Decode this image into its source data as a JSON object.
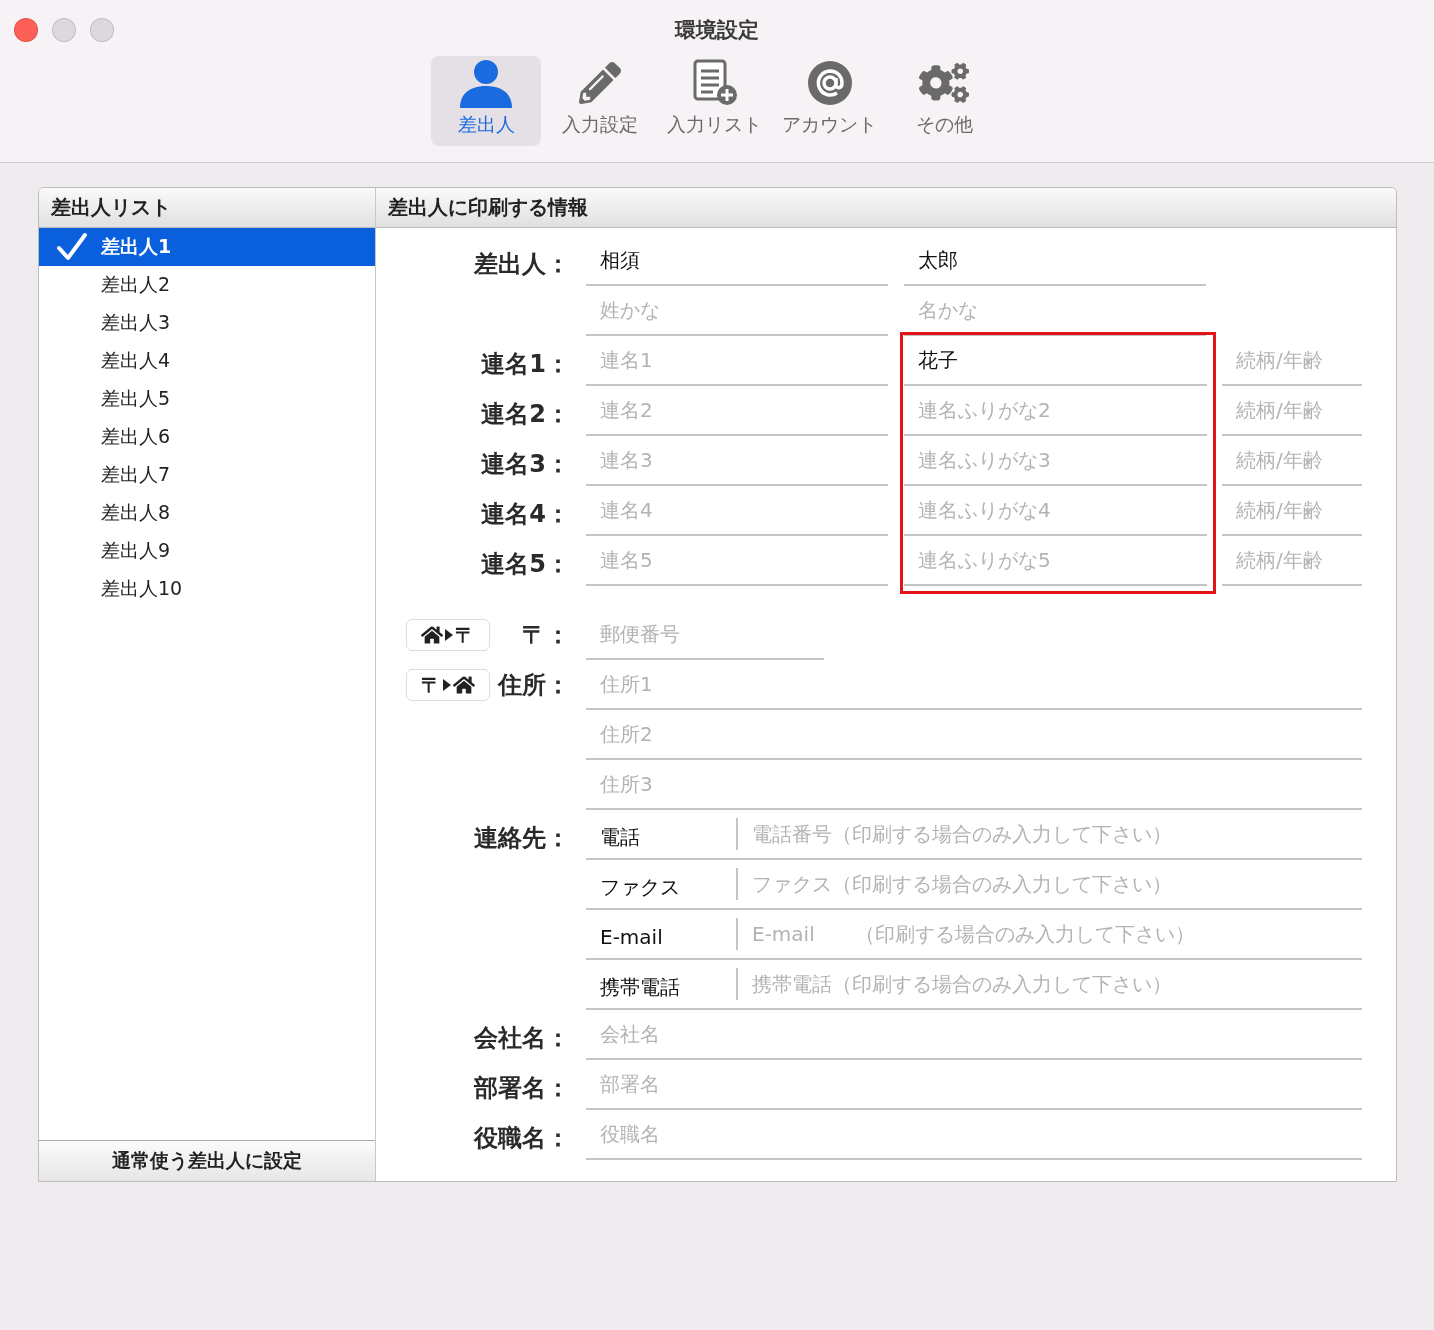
{
  "window": {
    "title": "環境設定"
  },
  "toolbar": [
    {
      "kind": "person",
      "label": "差出人",
      "selected": true
    },
    {
      "kind": "pencil",
      "label": "入力設定",
      "selected": false
    },
    {
      "kind": "list",
      "label": "入力リスト",
      "selected": false
    },
    {
      "kind": "at",
      "label": "アカウント",
      "selected": false
    },
    {
      "kind": "gears",
      "label": "その他",
      "selected": false
    }
  ],
  "sender_list": {
    "title": "差出人リスト",
    "items": [
      {
        "label": "差出人1",
        "selected": true
      },
      {
        "label": "差出人2",
        "selected": false
      },
      {
        "label": "差出人3",
        "selected": false
      },
      {
        "label": "差出人4",
        "selected": false
      },
      {
        "label": "差出人5",
        "selected": false
      },
      {
        "label": "差出人6",
        "selected": false
      },
      {
        "label": "差出人7",
        "selected": false
      },
      {
        "label": "差出人8",
        "selected": false
      },
      {
        "label": "差出人9",
        "selected": false
      },
      {
        "label": "差出人10",
        "selected": false
      }
    ],
    "button": "通常使う差出人に設定"
  },
  "form": {
    "title": "差出人に印刷する情報",
    "sender": {
      "label": "差出人：",
      "last_name": {
        "value": "相須"
      },
      "first_name": {
        "value": "太郎"
      },
      "last_kana": {
        "placeholder": "姓かな"
      },
      "first_kana": {
        "placeholder": "名かな"
      }
    },
    "joint_names_highlighted": true,
    "joint_names": [
      {
        "label": "連名1：",
        "name": {
          "placeholder": "連名1"
        },
        "furigana": {
          "value": "花子"
        },
        "relation": {
          "placeholder": "続柄/年齢"
        }
      },
      {
        "label": "連名2：",
        "name": {
          "placeholder": "連名2"
        },
        "furigana": {
          "placeholder": "連名ふりがな2"
        },
        "relation": {
          "placeholder": "続柄/年齢"
        }
      },
      {
        "label": "連名3：",
        "name": {
          "placeholder": "連名3"
        },
        "furigana": {
          "placeholder": "連名ふりがな3"
        },
        "relation": {
          "placeholder": "続柄/年齢"
        }
      },
      {
        "label": "連名4：",
        "name": {
          "placeholder": "連名4"
        },
        "furigana": {
          "placeholder": "連名ふりがな4"
        },
        "relation": {
          "placeholder": "続柄/年齢"
        }
      },
      {
        "label": "連名5：",
        "name": {
          "placeholder": "連名5"
        },
        "furigana": {
          "placeholder": "連名ふりがな5"
        },
        "relation": {
          "placeholder": "続柄/年齢"
        }
      }
    ],
    "postal": {
      "button_mark": "〒",
      "label": "〒：",
      "placeholder": "郵便番号"
    },
    "address": {
      "button_mark": "〒",
      "label": "住所：",
      "lines": [
        {
          "placeholder": "住所1"
        },
        {
          "placeholder": "住所2"
        },
        {
          "placeholder": "住所3"
        }
      ]
    },
    "contacts": {
      "label": "連絡先：",
      "rows": [
        {
          "label": "電話",
          "placeholder": "電話番号（印刷する場合のみ入力して下さい）"
        },
        {
          "label": "ファクス",
          "placeholder": "ファクス（印刷する場合のみ入力して下さい）"
        },
        {
          "label": "E-mail",
          "placeholder": "E-mail　　（印刷する場合のみ入力して下さい）"
        },
        {
          "label": "携帯電話",
          "placeholder": "携帯電話（印刷する場合のみ入力して下さい）"
        }
      ]
    },
    "company": [
      {
        "label": "会社名：",
        "placeholder": "会社名"
      },
      {
        "label": "部署名：",
        "placeholder": "部署名"
      },
      {
        "label": "役職名：",
        "placeholder": "役職名"
      }
    ]
  }
}
